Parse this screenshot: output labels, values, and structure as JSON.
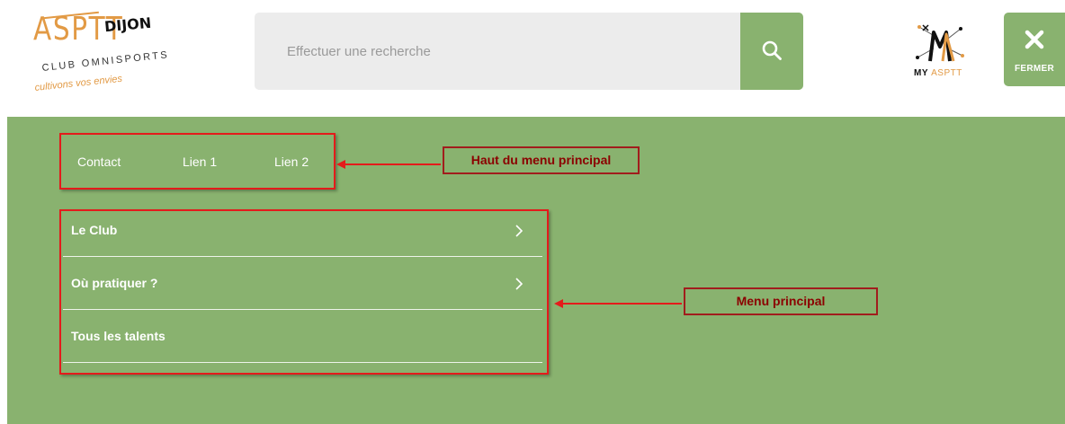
{
  "header": {
    "logo": {
      "mark": "ASPTT",
      "city": "DIJON",
      "subtitle": "CLUB OMNISPORTS",
      "tagline": "cultivons vos envies"
    },
    "search": {
      "placeholder": "Effectuer une recherche",
      "icon": "search-icon"
    },
    "my_asptt": {
      "label_prefix": "MY",
      "label_suffix": "ASPTT"
    },
    "close": {
      "label": "FERMER",
      "icon": "close-icon"
    }
  },
  "top_links": [
    "Contact",
    "Lien 1",
    "Lien 2"
  ],
  "main_menu": [
    {
      "label": "Le Club",
      "has_submenu": true
    },
    {
      "label": "Où pratiquer ?",
      "has_submenu": true
    },
    {
      "label": "Tous les talents",
      "has_submenu": false
    }
  ],
  "annotations": {
    "top_menu": "Haut du menu principal",
    "main_menu": "Menu principal"
  },
  "colors": {
    "accent_green": "#89b26f",
    "brand_orange": "#e29a45",
    "annotation_red": "#e41b1b",
    "annotation_text": "#8b0000"
  }
}
